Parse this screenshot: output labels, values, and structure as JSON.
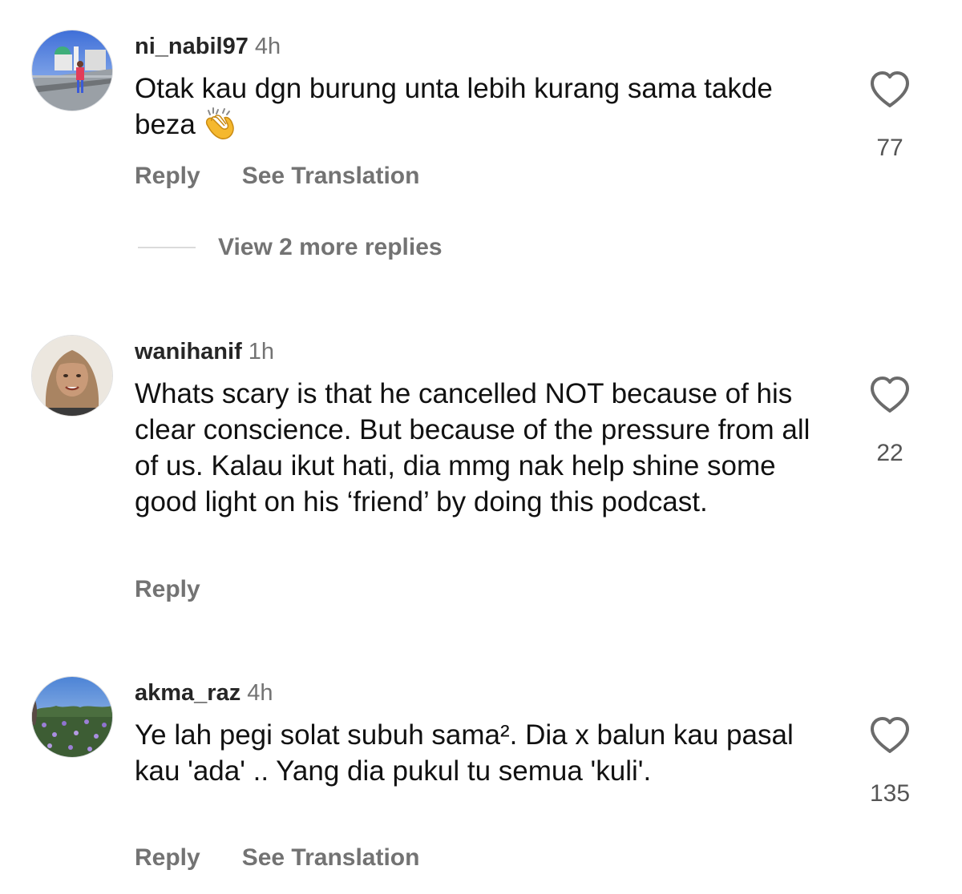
{
  "comments": [
    {
      "username": "ni_nabil97",
      "time": "4h",
      "text": "Otak kau dgn burung unta lebih kurang sama takde beza",
      "emoji": "clapping-hands",
      "likes": "77",
      "reply_label": "Reply",
      "translate_label": "See Translation",
      "view_replies_label": "View 2 more replies"
    },
    {
      "username": "wanihanif",
      "time": "1h",
      "text": "Whats scary is that he cancelled NOT because of his clear conscience. But because of the pressure from all of us. Kalau ikut hati, dia mmg nak help shine some good light on his ‘friend’ by doing this podcast.",
      "likes": "22",
      "reply_label": "Reply"
    },
    {
      "username": "akma_raz",
      "time": "4h",
      "text": "Ye lah pegi solat subuh sama². Dia x balun kau pasal kau 'ada' .. Yang dia pukul tu semua 'kuli'.",
      "likes": "135",
      "reply_label": "Reply",
      "translate_label": "See Translation"
    }
  ],
  "icons": {
    "like": "heart-outline-icon",
    "emoji": "clapping-hands-icon"
  },
  "colors": {
    "username": "#262626",
    "secondary_text": "#737373",
    "body_text": "#111111",
    "divider": "#dbdbdb"
  }
}
